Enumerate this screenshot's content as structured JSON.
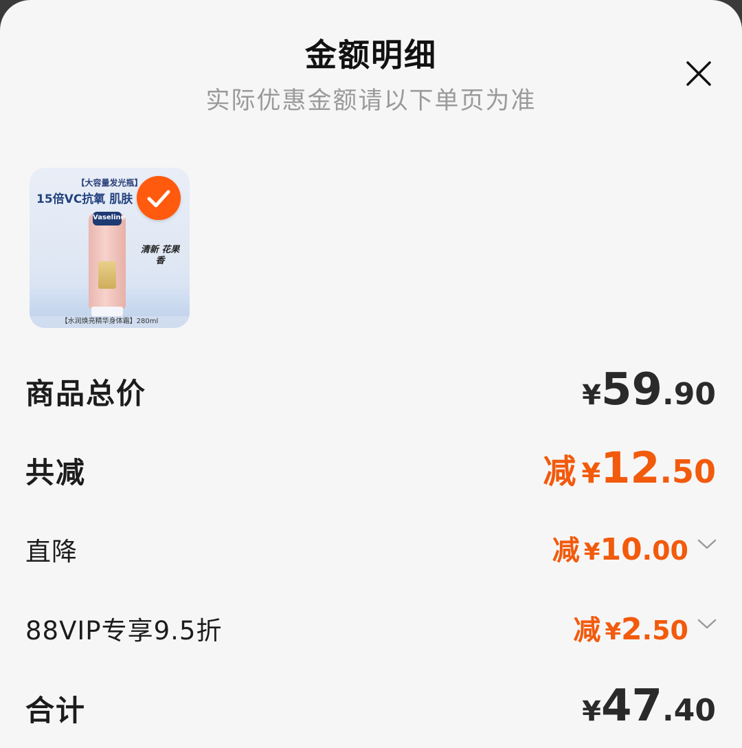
{
  "header": {
    "title": "金额明细",
    "subtitle": "实际优惠金额请以下单页为准"
  },
  "product": {
    "tag": "【大容量发光瓶】",
    "headline": "15倍VC抗氧 肌肤",
    "brand": "Vaseline",
    "scent": "清新 花果香",
    "footer": "【水润焕亮精华身体霜】280ml",
    "selected": true
  },
  "rows": {
    "total_price": {
      "label": "商品总价",
      "currency": "¥",
      "int": "59",
      "dec": ".90"
    },
    "total_discount": {
      "label": "共减",
      "prefix": "减",
      "currency": "¥",
      "int": "12",
      "dec": ".50"
    },
    "direct_discount": {
      "label": "直降",
      "prefix": "减",
      "currency": "¥",
      "int": "10",
      "dec": ".00"
    },
    "vip_discount": {
      "label": "88VIP专享9.5折",
      "prefix": "减",
      "currency": "¥",
      "int": "2",
      "dec": ".50"
    },
    "sum": {
      "label": "合计",
      "currency": "¥",
      "int": "47",
      "dec": ".40"
    }
  },
  "colors": {
    "accent": "#f25a0c",
    "checkmark_bg": "#ff5a0d",
    "background": "#f6f6f6"
  }
}
